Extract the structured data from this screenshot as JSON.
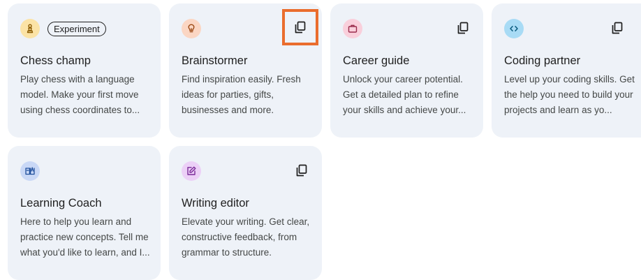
{
  "cards": [
    {
      "title": "Chess champ",
      "description": "Play chess with a language model. Make your first move using chess coordinates to...",
      "badge": "Experiment",
      "icon": "chess-pawn-icon",
      "icon_bg": "#fbe3a6",
      "icon_color": "#8a5a00"
    },
    {
      "title": "Brainstormer",
      "description": "Find inspiration easily. Fresh ideas for parties, gifts, businesses and more.",
      "icon": "lightbulb-icon",
      "icon_bg": "#fbd6c3",
      "icon_color": "#9c4a16",
      "copy_icon": "copy-icon",
      "copy_highlighted": true
    },
    {
      "title": "Career guide",
      "description": "Unlock your career potential. Get a detailed plan to refine your skills and achieve your...",
      "icon": "briefcase-icon",
      "icon_bg": "#f9cfdb",
      "icon_color": "#9a2c4c",
      "copy_icon": "copy-icon"
    },
    {
      "title": "Coding partner",
      "description": "Level up your coding skills. Get the help you need to build your projects and learn as yo...",
      "icon": "code-icon",
      "icon_bg": "#a8dbf5",
      "icon_color": "#0b5c80",
      "copy_icon": "copy-icon"
    },
    {
      "title": "Learning Coach",
      "description": "Here to help you learn and practice new concepts. Tell me what you'd like to learn, and I...",
      "icon": "book-icon",
      "icon_bg": "#c9d8f6",
      "icon_color": "#1f4f9c"
    },
    {
      "title": "Writing editor",
      "description": "Elevate your writing. Get clear, constructive feedback, from grammar to structure.",
      "icon": "edit-icon",
      "icon_bg": "#ecd0f7",
      "icon_color": "#7a2a98",
      "copy_icon": "copy-icon"
    }
  ],
  "highlight_color": "#ea6d2d"
}
